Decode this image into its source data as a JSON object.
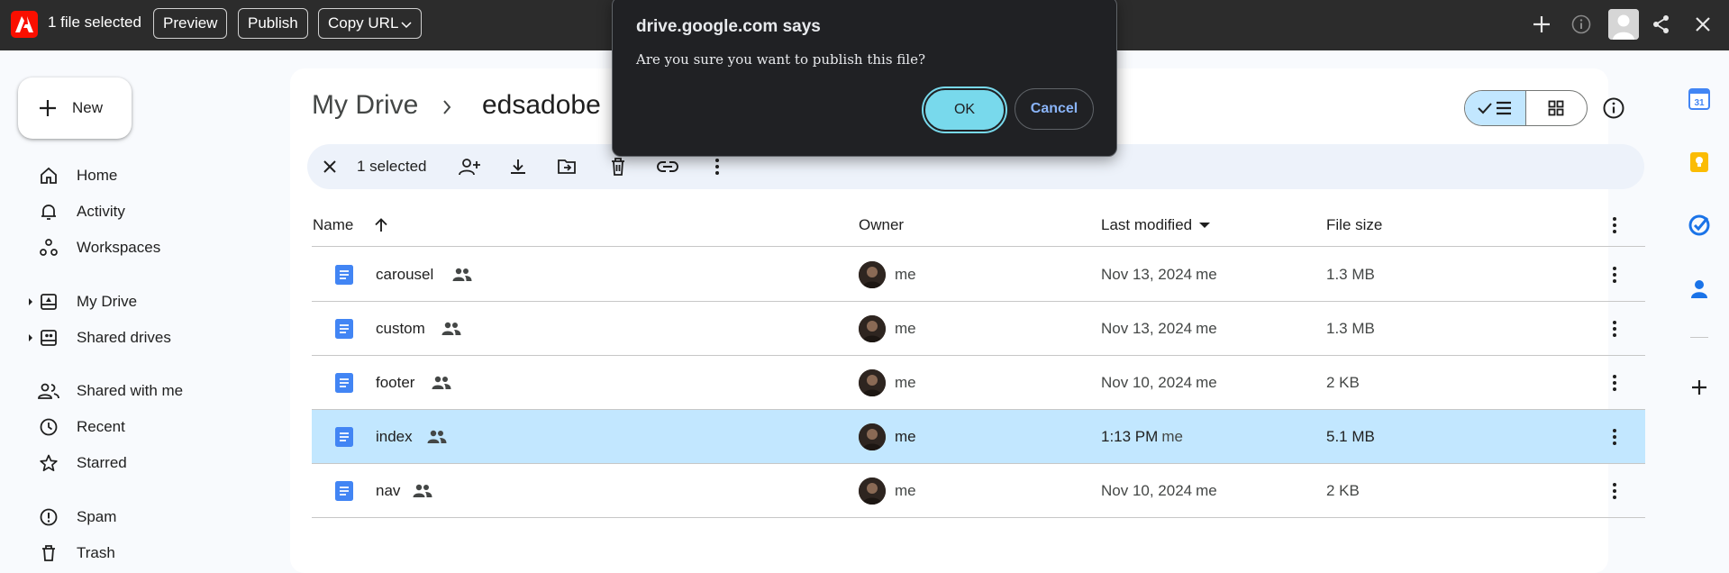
{
  "extension_bar": {
    "selection_text": "1 file selected",
    "buttons": {
      "preview": "Preview",
      "publish": "Publish",
      "copy_url": "Copy URL"
    },
    "icons": [
      "adobe-logo-icon",
      "plus-icon",
      "info-icon",
      "avatar",
      "share-icon",
      "close-icon"
    ]
  },
  "sidebar": {
    "new_label": "New",
    "items": [
      {
        "label": "Home",
        "icon": "home-icon"
      },
      {
        "label": "Activity",
        "icon": "bell-icon"
      },
      {
        "label": "Workspaces",
        "icon": "workspaces-icon"
      },
      {
        "label": "My Drive",
        "icon": "my-drive-icon",
        "expandable": true
      },
      {
        "label": "Shared drives",
        "icon": "shared-drives-icon",
        "expandable": true
      },
      {
        "label": "Shared with me",
        "icon": "people-icon"
      },
      {
        "label": "Recent",
        "icon": "clock-icon"
      },
      {
        "label": "Starred",
        "icon": "star-icon"
      },
      {
        "label": "Spam",
        "icon": "spam-icon"
      },
      {
        "label": "Trash",
        "icon": "trash-icon"
      }
    ]
  },
  "breadcrumb": {
    "root": "My Drive",
    "current": "edsadobe"
  },
  "selection_toolbar": {
    "count_label": "1 selected"
  },
  "table": {
    "headers": {
      "name": "Name",
      "owner": "Owner",
      "last_modified": "Last modified",
      "file_size": "File size"
    },
    "rows": [
      {
        "name": "carousel",
        "owner": "me",
        "modified": "Nov 13, 2024",
        "modified_by": "me",
        "size": "1.3 MB",
        "selected": false
      },
      {
        "name": "custom",
        "owner": "me",
        "modified": "Nov 13, 2024",
        "modified_by": "me",
        "size": "1.3 MB",
        "selected": false
      },
      {
        "name": "footer",
        "owner": "me",
        "modified": "Nov 10, 2024",
        "modified_by": "me",
        "size": "2 KB",
        "selected": false
      },
      {
        "name": "index",
        "owner": "me",
        "modified": "1:13 PM",
        "modified_by": "me",
        "size": "5.1 MB",
        "selected": true
      },
      {
        "name": "nav",
        "owner": "me",
        "modified": "Nov 10, 2024",
        "modified_by": "me",
        "size": "2 KB",
        "selected": false
      }
    ]
  },
  "right_rail": {
    "calendar_day": "31",
    "icons": [
      "calendar-icon",
      "keep-icon",
      "tasks-icon",
      "contacts-icon",
      "add-addon-icon"
    ]
  },
  "dialog": {
    "title": "drive.google.com says",
    "message": "Are you sure you want to publish this file?",
    "ok_label": "OK",
    "cancel_label": "Cancel"
  },
  "colors": {
    "dialog_bg": "#202124",
    "ok_button": "#78d9ec",
    "selected_row": "#c2e7ff",
    "doc_blue": "#4285f4",
    "adobe_red": "#fa0f00"
  }
}
